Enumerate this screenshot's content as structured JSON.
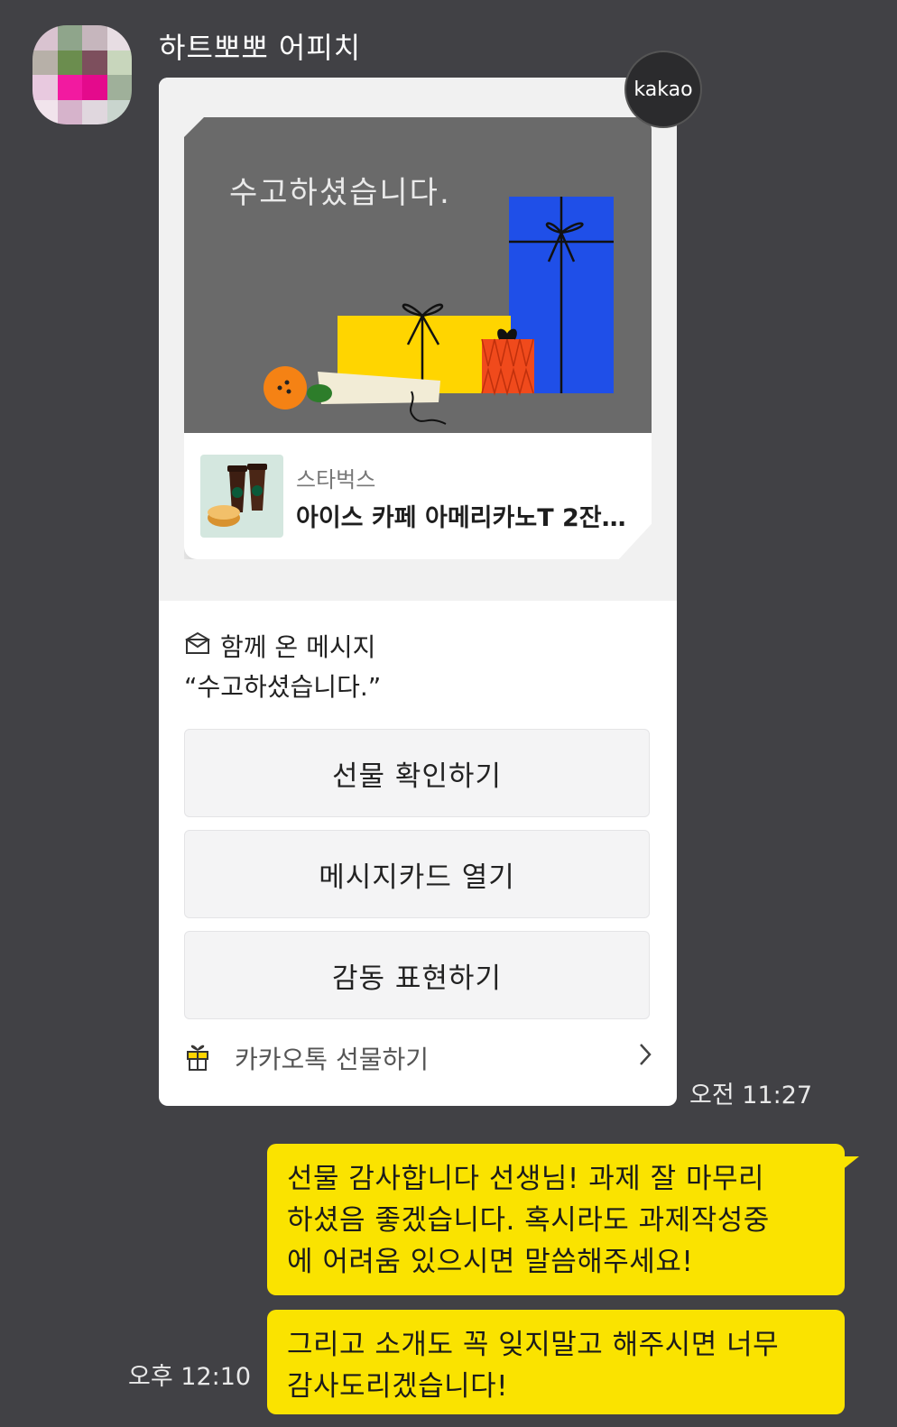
{
  "chat": {
    "sender_name": "하트뽀뽀 어피치",
    "kakao_badge": "kakao"
  },
  "gift_card": {
    "art_text": "수고하셨습니다.",
    "brand": "스타벅스",
    "product_name": "아이스 카페 아메리카노T 2잔…",
    "message_title": "함께 온 메시지",
    "message_body": "“수고하셨습니다.”",
    "buttons": [
      {
        "label": "선물 확인하기"
      },
      {
        "label": "메시지카드 열기"
      },
      {
        "label": "감동 표현하기"
      }
    ],
    "gift_link_label": "카카오톡 선물하기"
  },
  "times": {
    "received": "오전 11:27",
    "sent": "오후 12:10"
  },
  "messages": [
    {
      "lines": [
        "선물 감사합니다 선생님! 과제 잘 마무리",
        "하셨음 좋겠습니다. 혹시라도 과제작성중",
        "에 어려움 있으시면 말씀해주세요!"
      ]
    },
    {
      "lines": [
        "그리고 소개도 꼭 잊지말고 해주시면 너무",
        "감사도리겠습니다!"
      ]
    }
  ],
  "colors": {
    "background": "#414145",
    "bubble": "#fae300",
    "card": "#ffffff",
    "art_background": "#6a6a6a"
  },
  "icons": {
    "message": "envelope-icon",
    "gift": "gift-box-icon",
    "chevron": "chevron-right-icon"
  }
}
